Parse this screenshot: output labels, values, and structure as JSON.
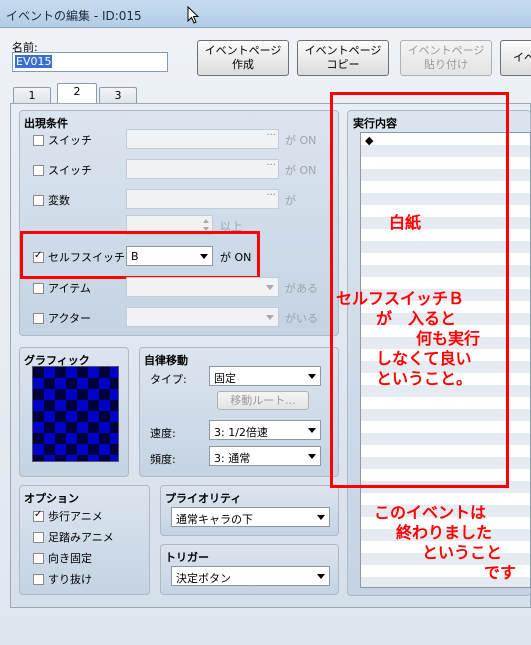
{
  "window": {
    "title": "イベントの編集 - ID:015"
  },
  "header": {
    "name_label": "名前:",
    "name_value": "EV015",
    "buttons": {
      "create_page": [
        "イベントページ",
        "作成"
      ],
      "copy_page": [
        "イベントページ",
        "コピー"
      ],
      "paste_page": [
        "イベントページ",
        "貼り付け"
      ],
      "next_partial": "イベ"
    }
  },
  "tabs": [
    "1",
    "2",
    "3"
  ],
  "active_tab": "2",
  "conditions": {
    "title": "出現条件",
    "rows": [
      {
        "label": "スイッチ",
        "checked": false,
        "value": "",
        "suffix": "が ON"
      },
      {
        "label": "スイッチ",
        "checked": false,
        "value": "",
        "suffix": "が ON"
      },
      {
        "label": "変数",
        "checked": false,
        "value": "",
        "suffix": "が"
      },
      {
        "label": "",
        "checked": false,
        "value": "",
        "suffix": "以上"
      },
      {
        "label": "セルフスイッチ",
        "checked": true,
        "value": "B",
        "suffix": "が ON"
      },
      {
        "label": "アイテム",
        "checked": false,
        "value": "",
        "suffix": "がある"
      },
      {
        "label": "アクター",
        "checked": false,
        "value": "",
        "suffix": "がいる"
      }
    ]
  },
  "graphic": {
    "title": "グラフィック"
  },
  "autonomous": {
    "title": "自律移動",
    "type_label": "タイプ:",
    "type_value": "固定",
    "route_button": "移動ルート...",
    "speed_label": "速度:",
    "speed_value": "3: 1/2倍速",
    "freq_label": "頻度:",
    "freq_value": "3: 通常"
  },
  "options": {
    "title": "オプション",
    "items": [
      {
        "label": "歩行アニメ",
        "checked": true
      },
      {
        "label": "足踏みアニメ",
        "checked": false
      },
      {
        "label": "向き固定",
        "checked": false
      },
      {
        "label": "すり抜け",
        "checked": false
      }
    ]
  },
  "priority": {
    "title": "プライオリティ",
    "value": "通常キャラの下"
  },
  "trigger": {
    "title": "トリガー",
    "value": "決定ボタン"
  },
  "contents": {
    "title": "実行内容",
    "first_line": "◆"
  },
  "annotations": {
    "blank": "白紙",
    "self_switch": [
      "セルフスイッチＢ",
      "が　入ると",
      "何も実行",
      "しなくて良い",
      "ということ。"
    ],
    "event_end": [
      "このイベントは",
      "終わりました",
      "ということ",
      "です"
    ]
  },
  "colors": {
    "annotation": "#ff0000",
    "graphic_dark": "#00003a",
    "graphic_light": "#0000c8"
  }
}
